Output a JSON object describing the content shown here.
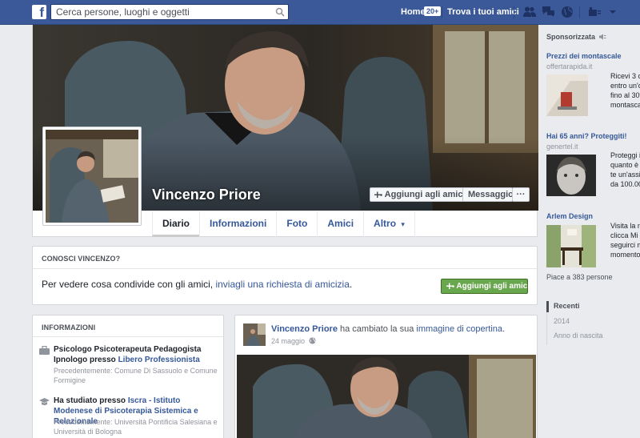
{
  "topbar": {
    "logo_letter": "f",
    "search_placeholder": "Cerca persone, luoghi e oggetti",
    "home_label": "Home",
    "home_badge": "20+",
    "find_friends_label": "Trova i tuoi amici"
  },
  "profile": {
    "name": "Vincenzo Priore",
    "add_friend_label": "Aggiungi agli amici",
    "message_label": "Messaggio",
    "more_label": "···",
    "tabs": [
      "Diario",
      "Informazioni",
      "Foto",
      "Amici",
      "Altro"
    ],
    "altro_arrow": "▾"
  },
  "know_box": {
    "title": "CONOSCI VINCENZO?",
    "text_before": "Per vedere cosa condivide con gli amici, ",
    "link_text": "inviagli una richiesta di amicizia",
    "text_after": ".",
    "button_label": "Aggiungi agli amici"
  },
  "info_box": {
    "title": "INFORMAZIONI",
    "items": [
      {
        "main": "Psicologo Psicoterapeuta Pedagogista Ipnologo presso ",
        "link": "Libero Professionista",
        "sub": "Precedentemente: Comune Di Sassuolo e Comune Formigine"
      },
      {
        "main": "Ha studiato presso ",
        "link": "Iscra - Istituto Modenese di Psicoterapia Sistemica e Relazionale",
        "sub": "Precedentemente: Università Pontificia Salesiana e Università di Bologna"
      }
    ]
  },
  "post": {
    "author": "Vincenzo Priore",
    "action": " ha cambiato la sua ",
    "action_link": "immagine di copertina",
    "action_end": ".",
    "date": "24 maggio"
  },
  "sidebar": {
    "sponsored_title": "Sponsorizzata",
    "ads": [
      {
        "title": "Prezzi dei montascale",
        "domain": "offertarapida.it",
        "text": [
          "Ricevi 3 c",
          "entro un'o",
          "fino al 30%",
          "montasca"
        ]
      },
      {
        "title": "Hai 65 anni? Proteggiti!",
        "domain": "genertel.it",
        "text": [
          "Proteggi i",
          "quanto è",
          "te un'assi",
          "da 100.00"
        ]
      },
      {
        "title": "Arlem Design",
        "domain": "",
        "text": [
          "Visita la n",
          "clicca Mi",
          "seguirci m",
          "momento"
        ]
      }
    ],
    "likes_text": "Piace a 383 persone",
    "timeline": [
      "Recenti",
      "2014",
      "Anno di nascita"
    ]
  },
  "colors": {
    "brand_blue": "#3b5998",
    "link_blue": "#365899",
    "green_button": "#69a74e"
  },
  "icons": [
    "facebook-logo-icon",
    "search-icon",
    "friend-requests-icon",
    "messages-icon",
    "notifications-icon",
    "privacy-icon",
    "settings-icon",
    "add-friend-icon",
    "work-icon",
    "education-icon",
    "globe-icon",
    "sponsored-icon"
  ]
}
